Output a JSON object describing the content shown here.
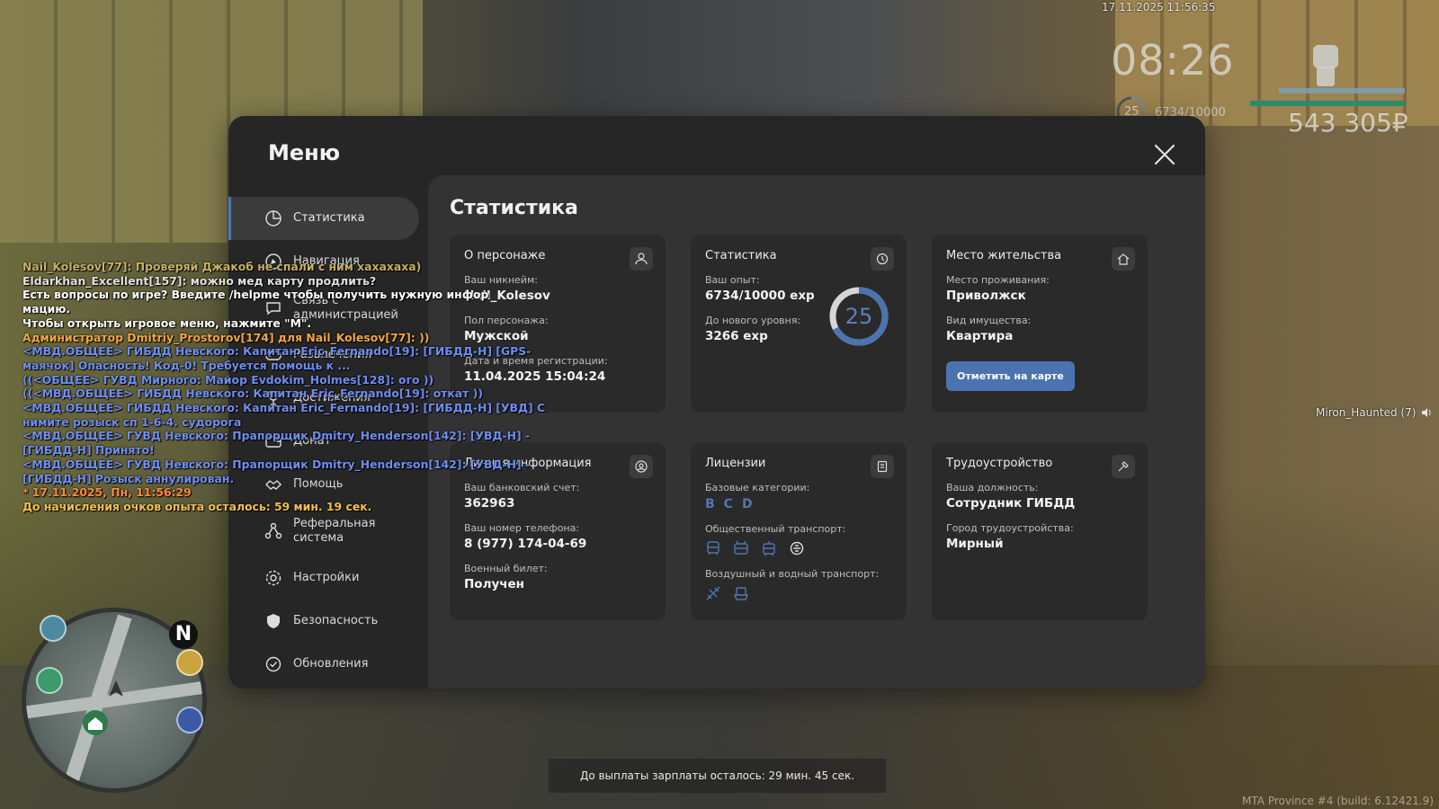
{
  "hud": {
    "datetime": "17.11.2025 11:56:35",
    "clock": "08:26",
    "level": "25",
    "exp": "6734/10000",
    "money": "543 305₽"
  },
  "voice": {
    "label": "Miron_Haunted (7)",
    "icon": "speaker-icon"
  },
  "chat": [
    {
      "text": "Nail_Kolesov[77]: Проверяй Джакоб не спали с ним хахахаха)",
      "color": "#c9b063"
    },
    {
      "text": "Eldarkhan_Excellent[157]: можно мед карту продлить?",
      "color": "#e0e0e0"
    },
    {
      "text": "Есть вопросы по игре? Введите /helpme чтобы получить нужную инфор",
      "color": "#ffffff"
    },
    {
      "text": "мацию.",
      "color": "#ffffff"
    },
    {
      "text": "Чтобы открыть игровое меню, нажмите \"M\".",
      "color": "#ffffff"
    },
    {
      "text": "Администратор Dmitriy_Prostorov[174] для Nail_Kolesov[77]: ))",
      "color": "#f4a640"
    },
    {
      "text": "<МВД.ОБЩЕЕ> ГИБДД Невского: Капитан Eric_Fernando[19]: [ГИБДД-Н] [GPS-",
      "color": "#6f8df0"
    },
    {
      "text": "маячок] Опасность! Код-0! Требуется помощь к ...",
      "color": "#6f8df0"
    },
    {
      "text": "((<ОБЩЕЕ> ГУВД Мирного: Майор Evdokim_Holmes[128]: ого ))",
      "color": "#6f8df0"
    },
    {
      "text": "((<МВД.ОБЩЕЕ> ГИБДД Невского: Капитан Eric_Fernando[19]: откат ))",
      "color": "#6f8df0"
    },
    {
      "text": "<МВД.ОБЩЕЕ> ГИБДД Невского: Капитан Eric_Fernando[19]: [ГИБДД-Н] [УВД] С",
      "color": "#6f8df0"
    },
    {
      "text": "нимите розыск сп 1-6-4. судорога",
      "color": "#6f8df0"
    },
    {
      "text": "<МВД.ОБЩЕЕ> ГУВД Невского: Прапорщик Dmitry_Henderson[142]: [УВД-Н] -",
      "color": "#6f8df0"
    },
    {
      "text": "[ГИБДД-Н] Принято!",
      "color": "#6f8df0"
    },
    {
      "text": "<МВД.ОБЩЕЕ> ГУВД Невского: Прапорщик Dmitry_Henderson[142]: [УВД-Н] -",
      "color": "#6f8df0"
    },
    {
      "text": "[ГИБДД-Н] Розыск аннулирован.",
      "color": "#6f8df0"
    },
    {
      "text": "* 17.11.2025, Пн, 11:56:29",
      "color": "#ff8a3d"
    },
    {
      "text": "До начисления очков опыта осталось: 59 мин. 19 сек.",
      "color": "#f2c14b"
    }
  ],
  "menu": {
    "title": "Меню",
    "sidebar": [
      {
        "label": "Статистика",
        "icon": "pie-chart-icon",
        "active": true
      },
      {
        "label": "Навигация",
        "icon": "navigation-icon"
      },
      {
        "label": "Связь с администрацией",
        "icon": "chat-icon"
      },
      {
        "label": "Развлечения",
        "icon": "gamepad-icon"
      },
      {
        "label": "Достижения",
        "icon": "trophy-icon"
      },
      {
        "label": "Донат",
        "icon": "wallet-icon"
      },
      {
        "label": "Помощь",
        "icon": "handshake-icon"
      },
      {
        "label": "Реферальная система",
        "icon": "referral-icon"
      },
      {
        "label": "Настройки",
        "icon": "gear-icon"
      },
      {
        "label": "Безопасность",
        "icon": "shield-icon"
      },
      {
        "label": "Обновления",
        "icon": "update-icon"
      }
    ],
    "content_title": "Статистика",
    "cards": {
      "character": {
        "title": "О персонаже",
        "nick_label": "Ваш никнейм:",
        "nick": "Nail_Kolesov",
        "gender_label": "Пол персонажа:",
        "gender": "Мужской",
        "reg_label": "Дата и время регистрации:",
        "reg": "11.04.2025 15:04:24"
      },
      "stats": {
        "title": "Статистика",
        "exp_label": "Ваш опыт:",
        "exp": "6734/10000 exp",
        "next_label": "До нового уровня:",
        "next": "3266 exp",
        "level": "25",
        "progress": 0.6734
      },
      "residence": {
        "title": "Место жительства",
        "place_label": "Место проживания:",
        "place": "Приволжск",
        "type_label": "Вид имущества:",
        "type": "Квартира",
        "button": "Отметить на карте"
      },
      "personal": {
        "title": "Личная информация",
        "bank_label": "Ваш банковский счет:",
        "bank": "362963",
        "phone_label": "Ваш номер телефона:",
        "phone": "8 (977) 174-04-69",
        "military_label": "Военный билет:",
        "military": "Получен"
      },
      "licenses": {
        "title": "Лицензии",
        "base_label": "Базовые категории:",
        "categories": [
          "B",
          "C",
          "D"
        ],
        "public_label": "Общественный транспорт:",
        "public_icons": [
          "bus-icon",
          "trolleybus-icon",
          "tram-icon",
          "taxi-icon"
        ],
        "air_label": "Воздушный и водный транспорт:",
        "air_icons": [
          "plane-icon",
          "boat-icon"
        ]
      },
      "employment": {
        "title": "Трудоустройство",
        "job_label": "Ваша должность:",
        "job": "Сотрудник ГИБДД",
        "city_label": "Город трудоустройства:",
        "city": "Мирный"
      }
    }
  },
  "salary": "До выплаты зарплаты осталось: 29 мин. 45 сек.",
  "build": "MTA Province #4 (build: 6.12421.9)",
  "minimap": {
    "north": "N"
  }
}
